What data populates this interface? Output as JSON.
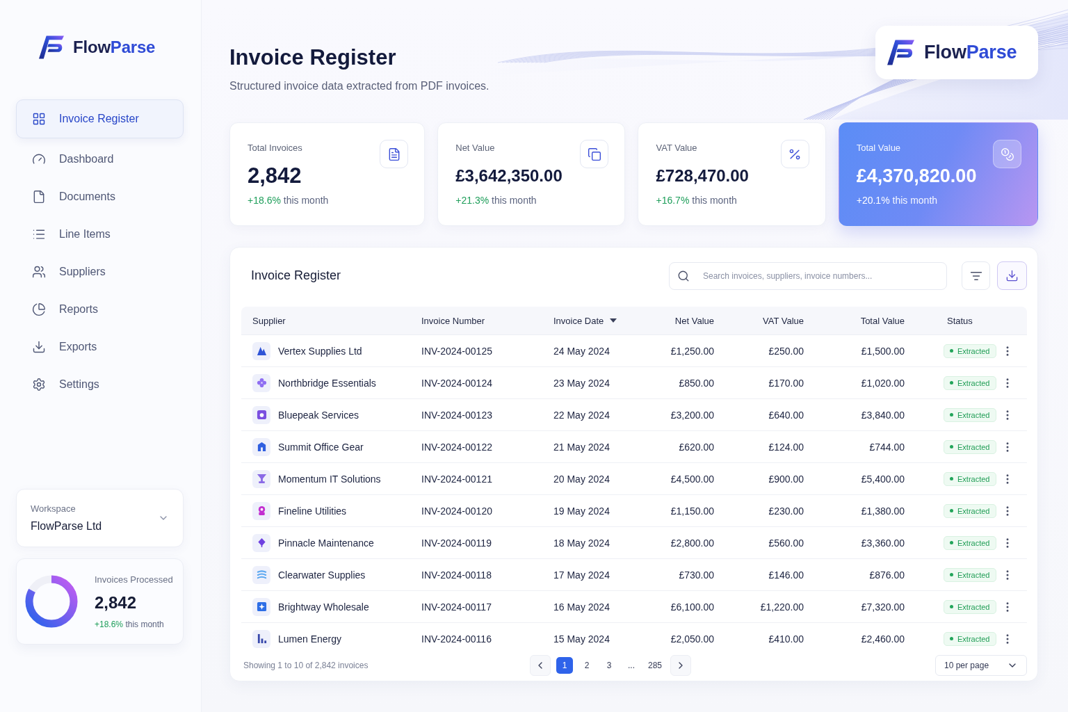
{
  "sidebar": {
    "logo": {
      "prefix": "Flow",
      "suffix": "Parse"
    },
    "nav": [
      {
        "label": "Invoice Register",
        "selected": true
      },
      {
        "label": "Dashboard",
        "selected": false
      },
      {
        "label": "Documents",
        "selected": false
      },
      {
        "label": "Line Items",
        "selected": false
      },
      {
        "label": "Suppliers",
        "selected": false
      },
      {
        "label": "Reports",
        "selected": false
      },
      {
        "label": "Exports",
        "selected": false
      },
      {
        "label": "Settings",
        "selected": false
      }
    ],
    "workspace": {
      "label": "Workspace",
      "value": "FlowParse Ltd"
    },
    "processed": {
      "label": "Invoices Processed",
      "value": "2,842",
      "change": "+18.6%",
      "period": "this month",
      "level": 0.83
    }
  },
  "header": {
    "title": "Invoice Register",
    "subtitle": "Structured invoice data extracted from PDF invoices.",
    "brand": {
      "prefix": "Flow",
      "suffix": "Parse"
    }
  },
  "stats": [
    {
      "label": "Total Invoices",
      "value": "2,842",
      "change": "+18.6%",
      "period": "this month",
      "highlighted": false
    },
    {
      "label": "Net Value",
      "value": "£3,642,350.00",
      "change": "+21.3%",
      "period": "this month",
      "highlighted": false
    },
    {
      "label": "VAT Value",
      "value": "£728,470.00",
      "change": "+16.7%",
      "period": "this month",
      "highlighted": false
    },
    {
      "label": "Total Value",
      "value": "£4,370,820.00",
      "change": "+20.1%",
      "period": "this month",
      "highlighted": true
    }
  ],
  "table": {
    "title": "Invoice Register",
    "search": {
      "placeholder": "Search invoices, suppliers, invoice numbers..."
    },
    "columns": [
      {
        "label": "Supplier",
        "sorted": false
      },
      {
        "label": "Invoice Number",
        "sorted": false
      },
      {
        "label": "Invoice Date",
        "sorted": true
      },
      {
        "label": "Net Value",
        "sorted": false
      },
      {
        "label": "VAT Value",
        "sorted": false
      },
      {
        "label": "Total Value",
        "sorted": false
      },
      {
        "label": "Status",
        "sorted": false
      }
    ],
    "rows": [
      {
        "supplier": "Vertex Supplies Ltd",
        "invoice_number": "INV-2024-00125",
        "invoice_date": "24 May 2024",
        "net_value": "£1,250.00",
        "vat_value": "£250.00",
        "total_value": "£1,500.00",
        "status": "Extracted"
      },
      {
        "supplier": "Northbridge Essentials",
        "invoice_number": "INV-2024-00124",
        "invoice_date": "23 May 2024",
        "net_value": "£850.00",
        "vat_value": "£170.00",
        "total_value": "£1,020.00",
        "status": "Extracted"
      },
      {
        "supplier": "Bluepeak Services",
        "invoice_number": "INV-2024-00123",
        "invoice_date": "22 May 2024",
        "net_value": "£3,200.00",
        "vat_value": "£640.00",
        "total_value": "£3,840.00",
        "status": "Extracted"
      },
      {
        "supplier": "Summit Office Gear",
        "invoice_number": "INV-2024-00122",
        "invoice_date": "21 May 2024",
        "net_value": "£620.00",
        "vat_value": "£124.00",
        "total_value": "£744.00",
        "status": "Extracted"
      },
      {
        "supplier": "Momentum IT Solutions",
        "invoice_number": "INV-2024-00121",
        "invoice_date": "20 May 2024",
        "net_value": "£4,500.00",
        "vat_value": "£900.00",
        "total_value": "£5,400.00",
        "status": "Extracted"
      },
      {
        "supplier": "Fineline Utilities",
        "invoice_number": "INV-2024-00120",
        "invoice_date": "19 May 2024",
        "net_value": "£1,150.00",
        "vat_value": "£230.00",
        "total_value": "£1,380.00",
        "status": "Extracted"
      },
      {
        "supplier": "Pinnacle Maintenance",
        "invoice_number": "INV-2024-00119",
        "invoice_date": "18 May 2024",
        "net_value": "£2,800.00",
        "vat_value": "£560.00",
        "total_value": "£3,360.00",
        "status": "Extracted"
      },
      {
        "supplier": "Clearwater Supplies",
        "invoice_number": "INV-2024-00118",
        "invoice_date": "17 May 2024",
        "net_value": "£730.00",
        "vat_value": "£146.00",
        "total_value": "£876.00",
        "status": "Extracted"
      },
      {
        "supplier": "Brightway Wholesale",
        "invoice_number": "INV-2024-00117",
        "invoice_date": "16 May 2024",
        "net_value": "£6,100.00",
        "vat_value": "£1,220.00",
        "total_value": "£7,320.00",
        "status": "Extracted"
      },
      {
        "supplier": "Lumen Energy",
        "invoice_number": "INV-2024-00116",
        "invoice_date": "15 May 2024",
        "net_value": "£2,050.00",
        "vat_value": "£410.00",
        "total_value": "£2,460.00",
        "status": "Extracted"
      }
    ],
    "footer": {
      "summary": "Showing 1 to 10 of 2,842 invoices",
      "pages": [
        {
          "label": "1",
          "selected": true
        },
        {
          "label": "2",
          "selected": false
        },
        {
          "label": "3",
          "selected": false
        },
        {
          "label": "...",
          "selected": false
        },
        {
          "label": "285",
          "selected": false
        }
      ],
      "per_page": "10 per page"
    }
  }
}
